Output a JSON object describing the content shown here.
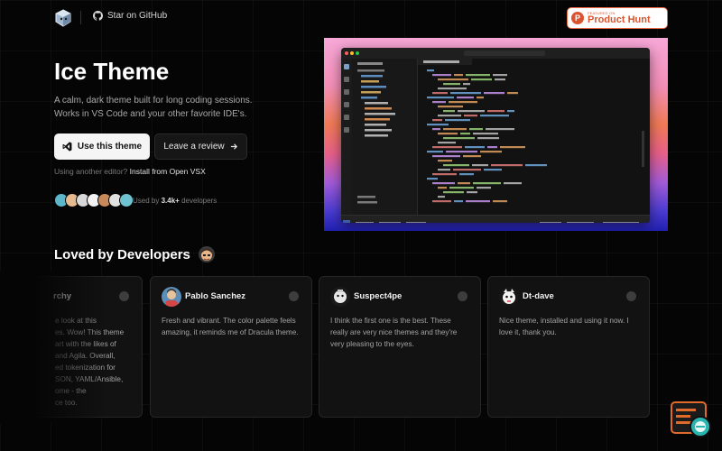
{
  "header": {
    "github_label": "Star on GitHub",
    "product_hunt": {
      "small": "FEATURED ON",
      "big": "Product Hunt"
    }
  },
  "hero": {
    "title": "Ice Theme",
    "subtitle_lines": [
      "A calm, dark theme built for long coding sessions.",
      "Works in VS Code and your other favorite IDE's."
    ],
    "primary_button": "Use this theme",
    "secondary_button": "Leave a review",
    "alt_prefix": "Using another editor?",
    "alt_link": "Install from Open VSX",
    "used_prefix": "Used by",
    "used_count": "3.4k+",
    "used_suffix": "developers"
  },
  "loved": {
    "title": "Loved by Developers",
    "cards": [
      {
        "name": "rchy",
        "lines": [
          "e look at this",
          "es. Wow! This theme",
          "art with the likes of",
          "and Agila. Overall,",
          "ed tokenization for",
          "SON, YAML/Ansible,",
          "ome - the",
          "ce too."
        ]
      },
      {
        "name": "Pablo Sanchez",
        "lines": [
          "Fresh and vibrant. The color palette feels",
          "amazing, it reminds me of Dracula theme."
        ]
      },
      {
        "name": "Suspect4pe",
        "lines": [
          "I think the first one is the best. These",
          "really are very nice themes and they're",
          "very pleasing to the eyes."
        ]
      },
      {
        "name": "Dt-dave",
        "lines": [
          "Nice theme, installed and using it now. I",
          "love it, thank you."
        ]
      }
    ]
  },
  "icons": {
    "logo": "ice-cube-logo-icon",
    "github": "github-icon",
    "vscode": "vscode-icon",
    "arrow": "arrow-right-icon",
    "reddit": "reddit-icon",
    "fab": "chat-bubble-icon"
  },
  "colors": {
    "background": "#050505",
    "card_bg": "#121212",
    "product_hunt": "#da552f",
    "fab_orange": "#e06a2a",
    "fab_teal": "#2bb5b0"
  }
}
